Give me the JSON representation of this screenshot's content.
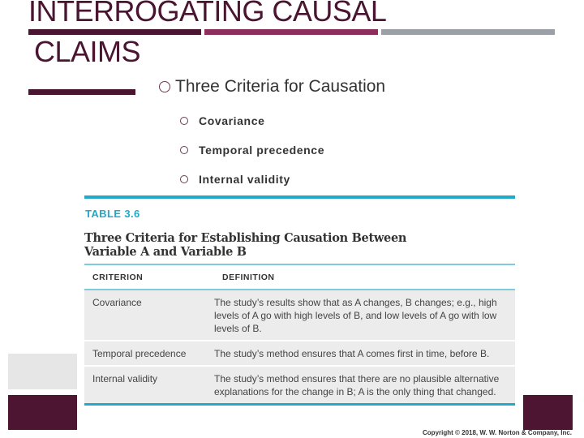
{
  "slide": {
    "title_line1": "INTERROGATING CAUSAL",
    "title_line2": "CLAIMS",
    "main_bullet": "Three Criteria for Causation",
    "sub_bullets": [
      "Covariance",
      "Temporal precedence",
      "Internal validity"
    ],
    "colors": {
      "plum": "#4a1530",
      "magenta": "#8e2e5f",
      "gray": "#9aa0a6",
      "teal": "#20a9c9"
    }
  },
  "table": {
    "label": "TABLE 3.6",
    "caption_line1": "Three Criteria for Establishing Causation Between",
    "caption_line2": "Variable A and Variable B",
    "headers": [
      "CRITERION",
      "DEFINITION"
    ],
    "rows": [
      {
        "criterion": "Covariance",
        "definition": "The study’s results show that as A changes, B changes; e.g., high levels of A go with high levels of B, and low levels of A go with low levels of B."
      },
      {
        "criterion": "Temporal precedence",
        "definition": "The study’s method ensures that A comes first in time, before B."
      },
      {
        "criterion": "Internal validity",
        "definition": "The study’s method ensures that there are no plausible alternative explanations for the change in B; A is the only thing that changed."
      }
    ],
    "copyright": "Copyright © 2018, W. W. Norton & Company, Inc."
  }
}
